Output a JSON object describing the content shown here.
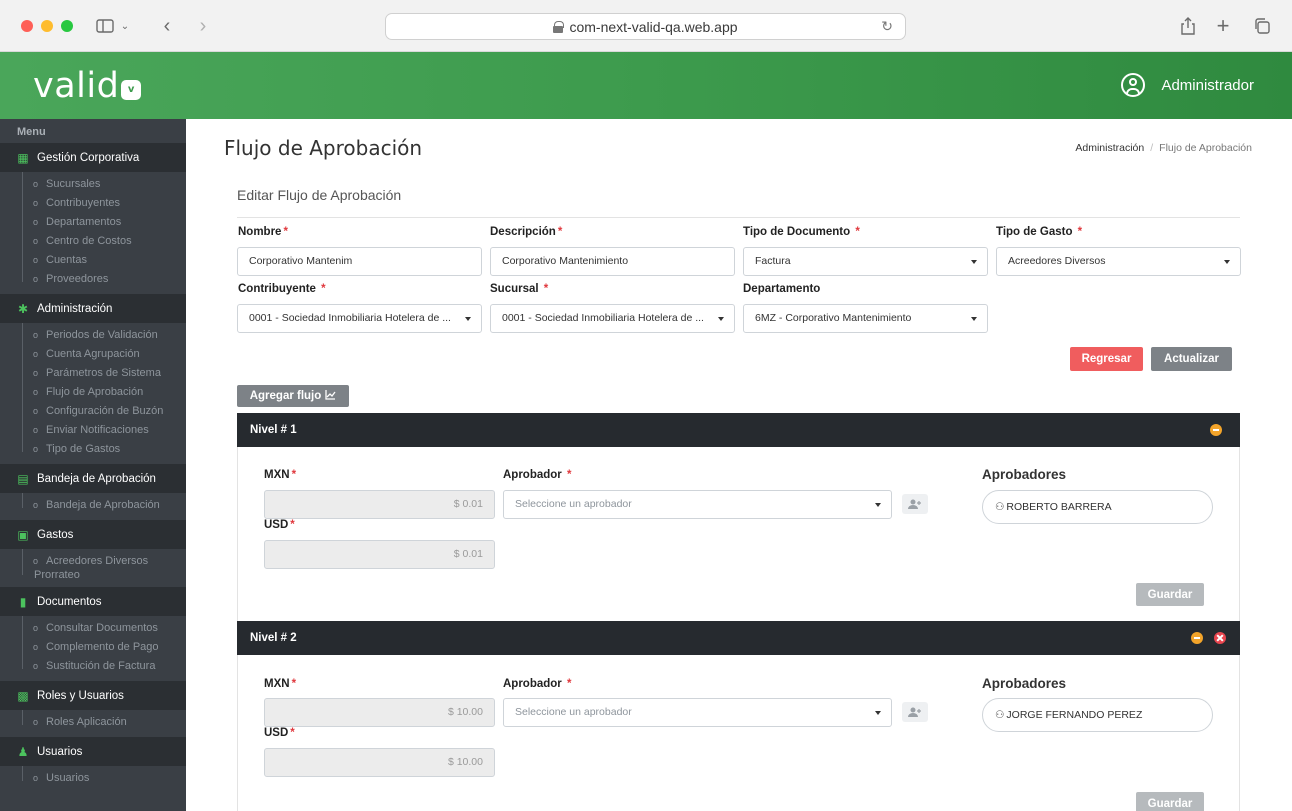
{
  "browser": {
    "url": "com-next-valid-qa.web.app"
  },
  "header": {
    "logo_text": "valid",
    "logo_badge": "v",
    "user_name": "Administrador"
  },
  "sidebar": {
    "menu_label": "Menu",
    "sections": [
      {
        "label": "Gestión Corporativa",
        "icon": "building-icon",
        "items": [
          "Sucursales",
          "Contribuyentes",
          "Departamentos",
          "Centro de Costos",
          "Cuentas",
          "Proveedores"
        ]
      },
      {
        "label": "Administración",
        "icon": "gear-icon",
        "items": [
          "Periodos de Validación",
          "Cuenta Agrupación",
          "Parámetros de Sistema",
          "Flujo de Aprobación",
          "Configuración de Buzón",
          "Enviar Notificaciones",
          "Tipo de Gastos"
        ]
      },
      {
        "label": "Bandeja de Aprobación",
        "icon": "inbox-icon",
        "items": [
          "Bandeja de Aprobación"
        ]
      },
      {
        "label": "Gastos",
        "icon": "money-icon",
        "items": [
          "Acreedores Diversos Prorrateo"
        ]
      },
      {
        "label": "Documentos",
        "icon": "document-icon",
        "items": [
          "Consultar Documentos",
          "Complemento de Pago",
          "Sustitución de Factura"
        ]
      },
      {
        "label": "Roles y Usuarios",
        "icon": "id-card-icon",
        "items": [
          "Roles Aplicación"
        ]
      },
      {
        "label": "Usuarios",
        "icon": "users-icon",
        "items": [
          "Usuarios"
        ]
      }
    ]
  },
  "page": {
    "title": "Flujo de Aprobación",
    "breadcrumb": [
      "Administración",
      "Flujo de Aprobación"
    ],
    "card_title": "Editar Flujo de Aprobación"
  },
  "form": {
    "nombre": {
      "label": "Nombre",
      "value": "Corporativo Mantenim"
    },
    "descripcion": {
      "label": "Descripción",
      "value": "Corporativo Mantenimiento"
    },
    "tipo_documento": {
      "label": "Tipo de Documento",
      "value": "Factura"
    },
    "tipo_gasto": {
      "label": "Tipo de Gasto",
      "value": "Acreedores Diversos"
    },
    "contribuyente": {
      "label": "Contribuyente",
      "value": "0001 - Sociedad Inmobiliaria Hotelera de ..."
    },
    "sucursal": {
      "label": "Sucursal",
      "value": "0001 - Sociedad Inmobiliaria Hotelera de ..."
    },
    "departamento": {
      "label": "Departamento",
      "value": "6MZ - Corporativo Mantenimiento"
    },
    "required_mark": "*"
  },
  "actions": {
    "regresar": "Regresar",
    "actualizar": "Actualizar",
    "agregar_flujo": "Agregar flujo"
  },
  "levels": [
    {
      "title": "Nivel # 1",
      "mxn_label": "MXN",
      "mxn_value": "$ 0.01",
      "usd_label": "USD",
      "usd_value": "$ 0.01",
      "aprobador_label": "Aprobador",
      "aprobador_placeholder": "Seleccione un aprobador",
      "aprobadores_title": "Aprobadores",
      "aprobadores": [
        "ROBERTO BARRERA"
      ],
      "save_label": "Guardar"
    },
    {
      "title": "Nivel # 2",
      "mxn_label": "MXN",
      "mxn_value": "$ 10.00",
      "usd_label": "USD",
      "usd_value": "$ 10.00",
      "aprobador_label": "Aprobador",
      "aprobador_placeholder": "Seleccione un aprobador",
      "aprobadores_title": "Aprobadores",
      "aprobadores": [
        "JORGE FERNANDO PEREZ"
      ],
      "save_label": "Guardar"
    }
  ],
  "colors": {
    "brand_green": "#3d9b4d",
    "sidebar_bg": "#3a3f45",
    "danger": "#f05d5e",
    "level_bar": "#262a2f"
  }
}
